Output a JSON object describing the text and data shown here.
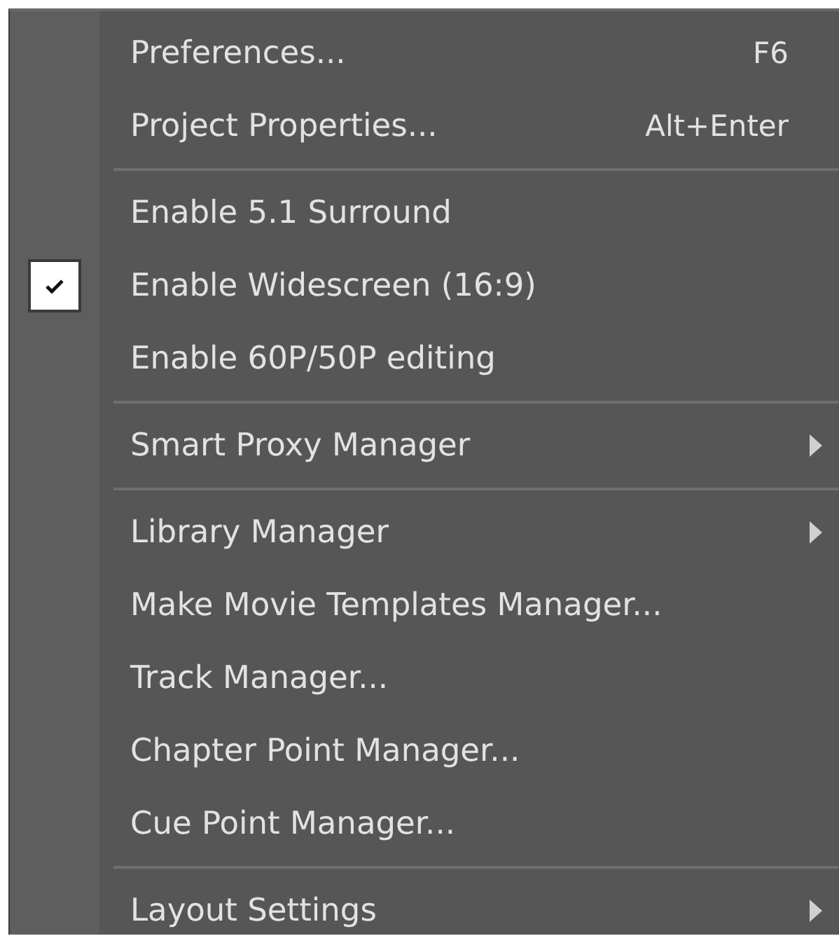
{
  "menu": {
    "entries": [
      {
        "kind": "item",
        "label": "Preferences...",
        "shortcut": "F6",
        "checked": false,
        "submenu": false
      },
      {
        "kind": "item",
        "label": "Project Properties...",
        "shortcut": "Alt+Enter",
        "checked": false,
        "submenu": false
      },
      {
        "kind": "separator"
      },
      {
        "kind": "item",
        "label": "Enable 5.1 Surround",
        "checked": false,
        "submenu": false
      },
      {
        "kind": "item",
        "label": "Enable Widescreen (16:9)",
        "checked": true,
        "submenu": false
      },
      {
        "kind": "item",
        "label": "Enable 60P/50P editing",
        "checked": false,
        "submenu": false
      },
      {
        "kind": "separator"
      },
      {
        "kind": "item",
        "label": "Smart Proxy Manager",
        "checked": false,
        "submenu": true
      },
      {
        "kind": "separator"
      },
      {
        "kind": "item",
        "label": "Library Manager",
        "checked": false,
        "submenu": true
      },
      {
        "kind": "item",
        "label": "Make Movie Templates Manager...",
        "checked": false,
        "submenu": false
      },
      {
        "kind": "item",
        "label": "Track Manager...",
        "checked": false,
        "submenu": false
      },
      {
        "kind": "item",
        "label": "Chapter Point Manager...",
        "checked": false,
        "submenu": false
      },
      {
        "kind": "item",
        "label": "Cue Point Manager...",
        "checked": false,
        "submenu": false
      },
      {
        "kind": "separator"
      },
      {
        "kind": "item",
        "label": "Layout Settings",
        "checked": false,
        "submenu": true
      }
    ]
  }
}
